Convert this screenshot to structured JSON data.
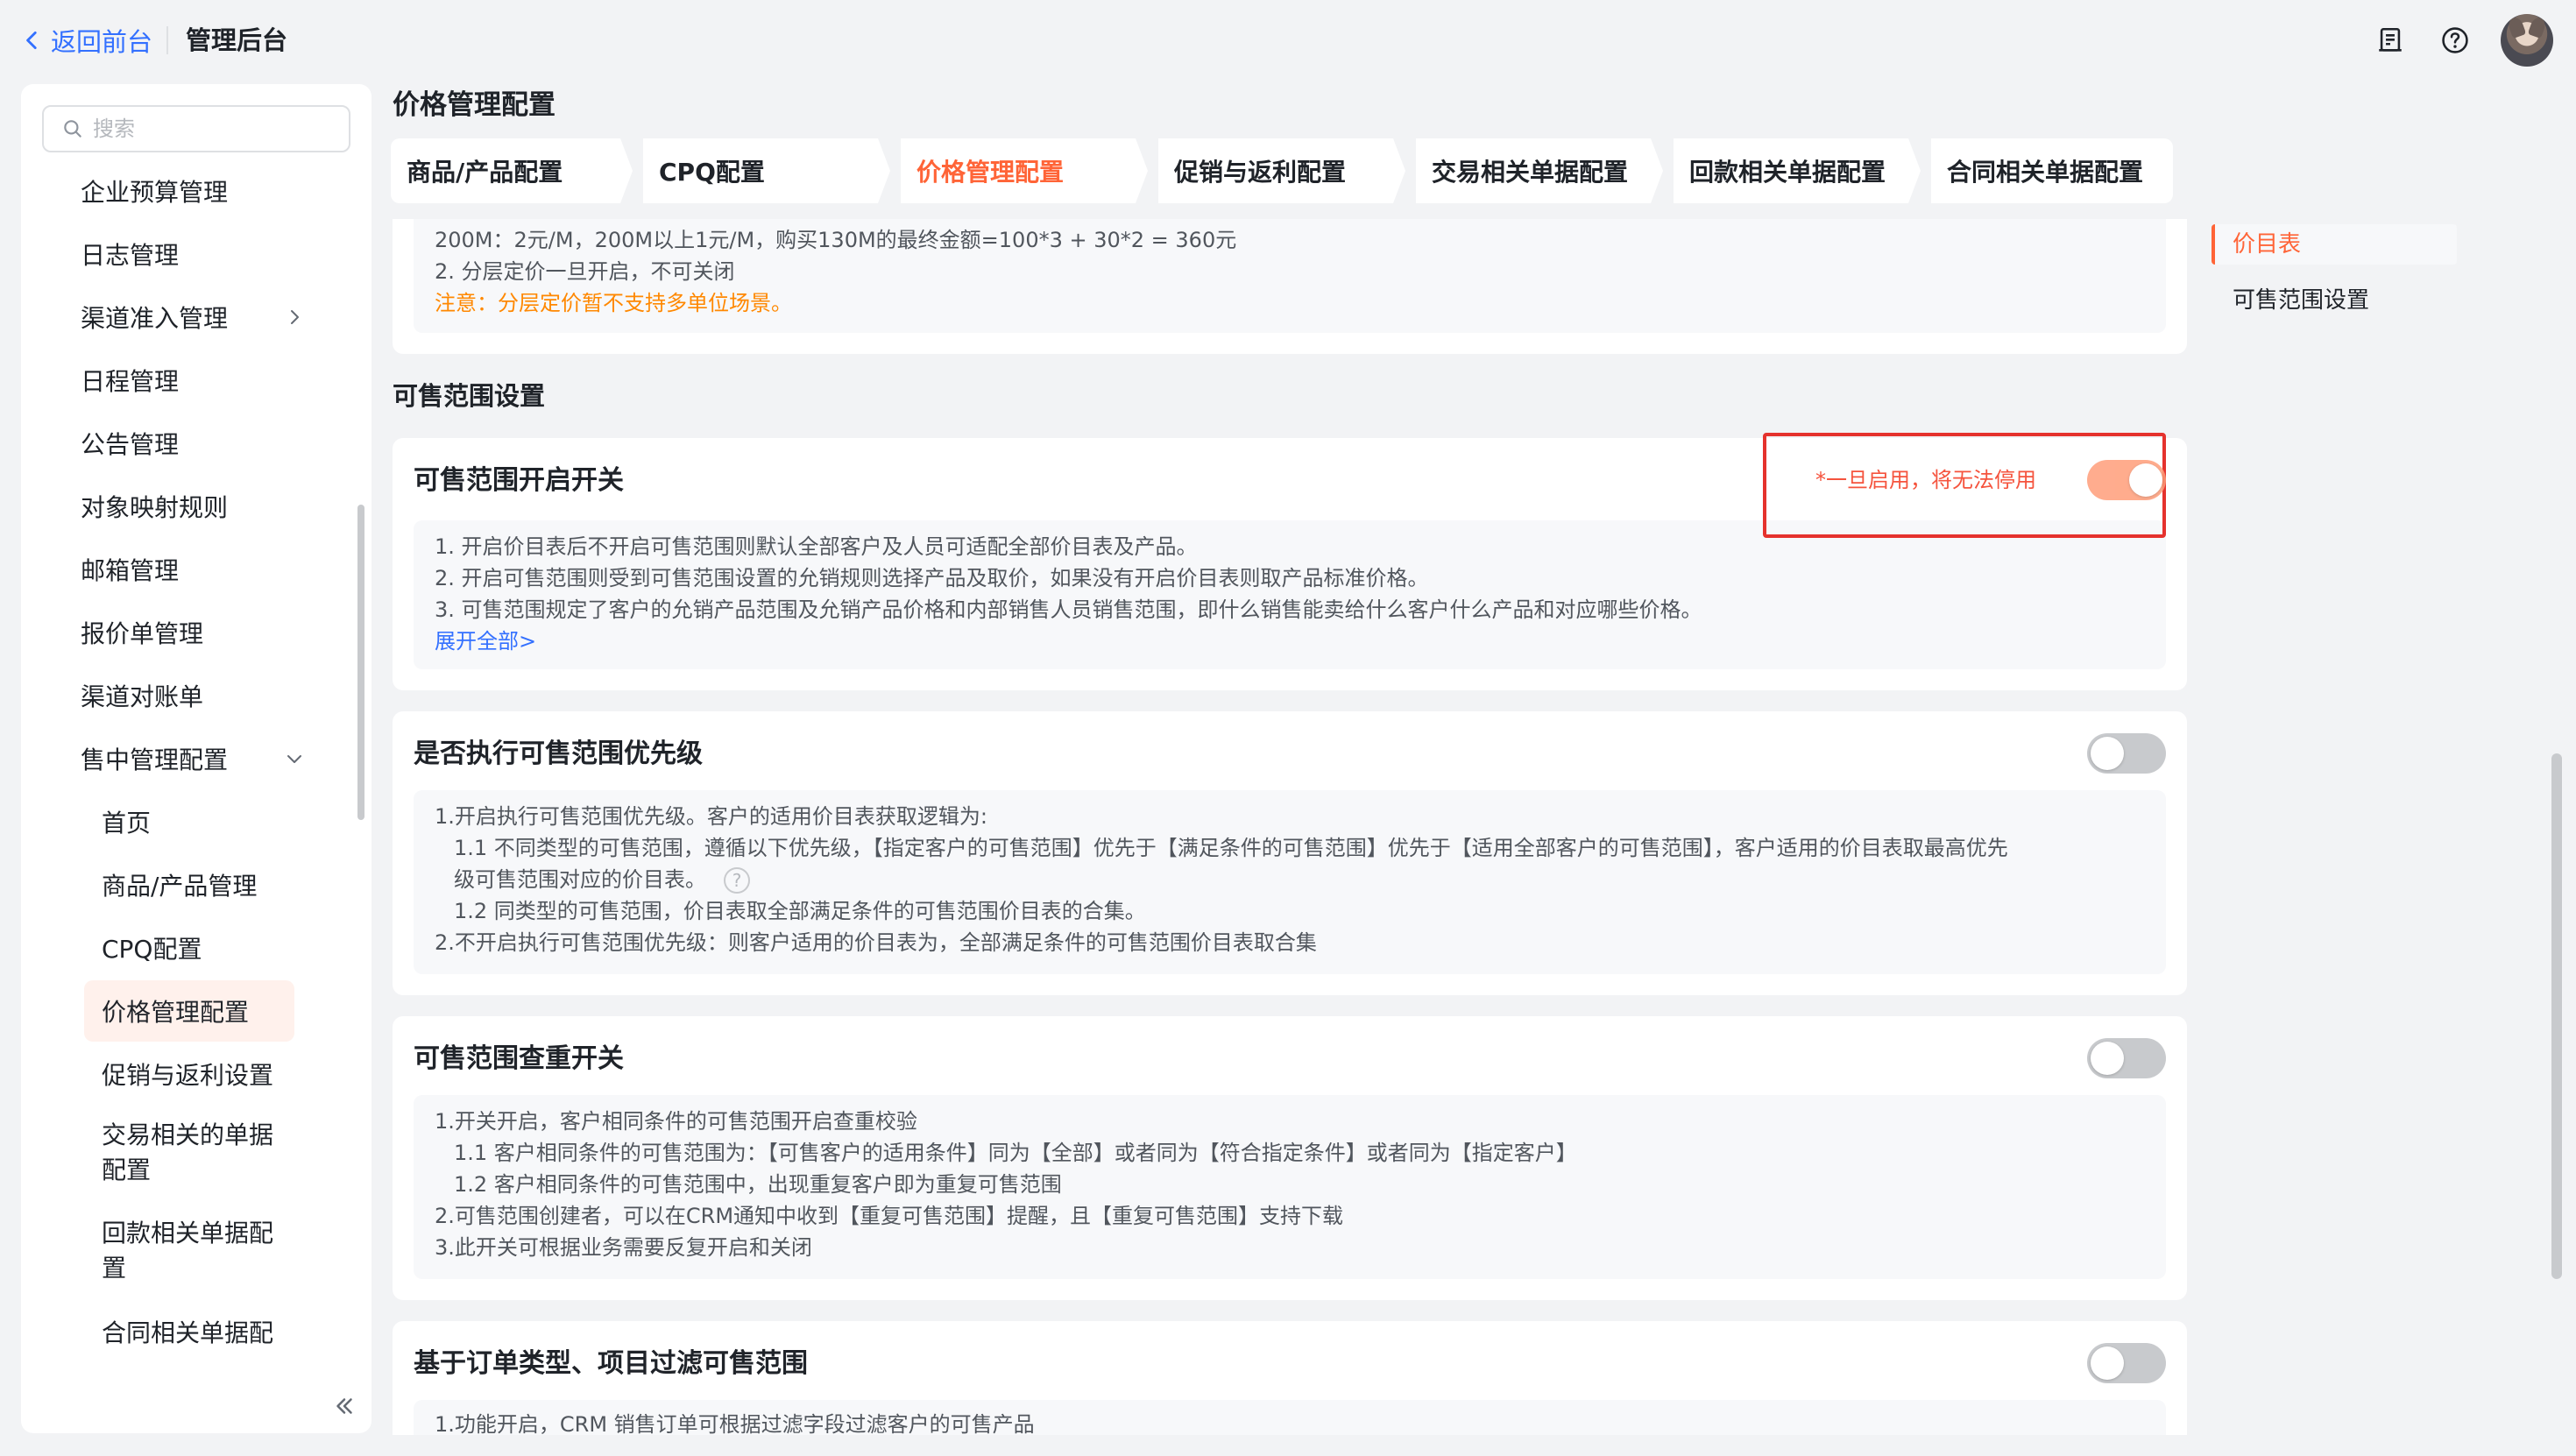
{
  "header": {
    "back_label": "返回前台",
    "title": "管理后台"
  },
  "sidebar": {
    "search_placeholder": "搜索",
    "items": [
      {
        "label": "企业预算管理"
      },
      {
        "label": "日志管理"
      },
      {
        "label": "渠道准入管理"
      },
      {
        "label": "日程管理"
      },
      {
        "label": "公告管理"
      },
      {
        "label": "对象映射规则"
      },
      {
        "label": "邮箱管理"
      },
      {
        "label": "报价单管理"
      },
      {
        "label": "渠道对账单"
      },
      {
        "label": "售中管理配置"
      }
    ],
    "sub_items": [
      {
        "label": "首页"
      },
      {
        "label": "商品/产品管理"
      },
      {
        "label": "CPQ配置"
      },
      {
        "label": "价格管理配置"
      },
      {
        "label": "促销与返利设置"
      },
      {
        "label": "交易相关的单据配置"
      },
      {
        "label": "回款相关单据配置"
      },
      {
        "label": "合同相关单据配"
      }
    ]
  },
  "main": {
    "page_title": "价格管理配置",
    "tabs": [
      {
        "label": "商品/产品配置"
      },
      {
        "label": "CPQ配置"
      },
      {
        "label": "价格管理配置"
      },
      {
        "label": "促销与返利配置"
      },
      {
        "label": "交易相关单据配置"
      },
      {
        "label": "回款相关单据配置"
      },
      {
        "label": "合同相关单据配置"
      }
    ],
    "top_card": {
      "line1": "200M：2元/M，200M以上1元/M，购买130M的最终金额=100*3 + 30*2 = 360元",
      "line2": "2. 分层定价一旦开启，不可关闭",
      "warning": "注意：分层定价暂不支持多单位场景。"
    },
    "section_title": "可售范围设置",
    "card1": {
      "title": "可售范围开启开关",
      "notice": "*一旦启用，将无法停用",
      "toggle_on": true,
      "lines": [
        "1. 开启价目表后不开启可售范围则默认全部客户及人员可适配全部价目表及产品。",
        "2. 开启可售范围则受到可售范围设置的允销规则选择产品及取价，如果没有开启价目表则取产品标准价格。",
        "3. 可售范围规定了客户的允销产品范围及允销产品价格和内部销售人员销售范围，即什么销售能卖给什么客户什么产品和对应哪些价格。"
      ],
      "expand_label": "展开全部>"
    },
    "card2": {
      "title": "是否执行可售范围优先级",
      "toggle_on": false,
      "lines": [
        "1.开启执行可售范围优先级。客户的适用价目表获取逻辑为:",
        "1.1 不同类型的可售范围，遵循以下优先级，【指定客户的可售范围】优先于【满足条件的可售范围】优先于【适用全部客户的可售范围】，客户适用的价目表取最高优先",
        "级可售范围对应的价目表。",
        "1.2 同类型的可售范围，价目表取全部满足条件的可售范围价目表的合集。",
        "2.不开启执行可售范围优先级：则客户适用的价目表为，全部满足条件的可售范围价目表取合集"
      ],
      "help_glyph": "?"
    },
    "card3": {
      "title": "可售范围查重开关",
      "toggle_on": false,
      "lines": [
        "1.开关开启，客户相同条件的可售范围开启查重校验",
        "1.1 客户相同条件的可售范围为：【可售客户的适用条件】同为【全部】或者同为【符合指定条件】或者同为【指定客户】",
        "1.2 客户相同条件的可售范围中，出现重复客户即为重复可售范围",
        "2.可售范围创建者，可以在CRM通知中收到【重复可售范围】提醒，且【重复可售范围】支持下载",
        "3.此开关可根据业务需要反复开启和关闭"
      ]
    },
    "card4": {
      "title": "基于订单类型、项目过滤可售范围",
      "toggle_on": false,
      "lines": [
        "1.功能开启，CRM 销售订单可根据过滤字段过滤客户的可售产品"
      ]
    }
  },
  "anchor_nav": {
    "items": [
      {
        "label": "价目表"
      },
      {
        "label": "可售范围设置"
      }
    ]
  },
  "colors": {
    "accent": "#ff6437",
    "link": "#3370ff",
    "warning": "#ff8800",
    "highlight_border": "#e5322d"
  },
  "icons": [
    "chevron-left-icon",
    "document-icon",
    "help-icon",
    "search-icon",
    "chevron-right-icon",
    "chevron-down-icon",
    "double-chevron-left-icon"
  ]
}
